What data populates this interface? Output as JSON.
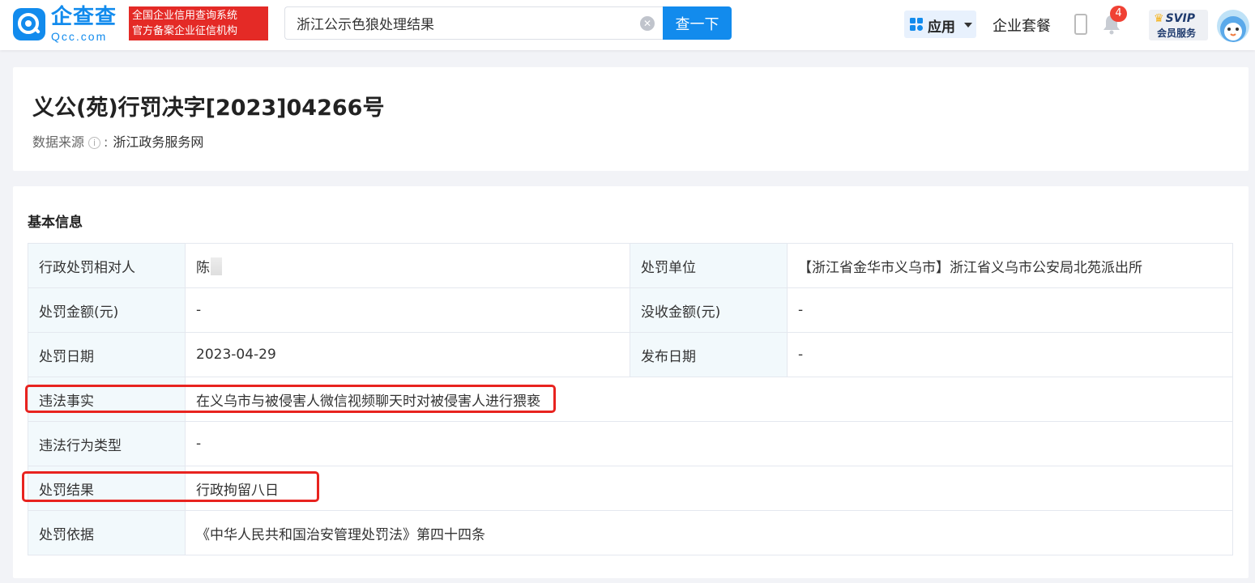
{
  "header": {
    "logo_cn": "企查查",
    "logo_en": "Qcc.com",
    "badge_line1": "全国企业信用查询系统",
    "badge_line2": "官方备案企业征信机构",
    "search_value": "浙江公示色狼处理结果",
    "search_button": "查一下",
    "app_label": "应用",
    "suite_label": "企业套餐",
    "notification_count": "4",
    "svip_label": "SVIP",
    "svip_sub": "会员服务"
  },
  "title_card": {
    "doc_title": "义公(苑)行罚决字[2023]04266号",
    "source_label": "数据来源",
    "source_value": "浙江政务服务网"
  },
  "basic_info": {
    "section_title": "基本信息",
    "rows": {
      "subject_label": "行政处罚相对人",
      "subject_value": "陈",
      "unit_label": "处罚单位",
      "unit_value": "【浙江省金华市义乌市】浙江省义乌市公安局北苑派出所",
      "fine_label": "处罚金额(元)",
      "fine_value": "-",
      "confiscate_label": "没收金额(元)",
      "confiscate_value": "-",
      "date_label": "处罚日期",
      "date_value": "2023-04-29",
      "publish_label": "发布日期",
      "publish_value": "-",
      "facts_label": "违法事实",
      "facts_value": "在义乌市与被侵害人微信视频聊天时对被侵害人进行猥亵",
      "type_label": "违法行为类型",
      "type_value": "-",
      "result_label": "处罚结果",
      "result_value": "行政拘留八日",
      "basis_label": "处罚依据",
      "basis_value": "《中华人民共和国治安管理处罚法》第四十四条"
    }
  },
  "colors": {
    "brand": "#128bed",
    "badge_red": "#e42a26",
    "highlight_red": "#e8231f",
    "label_bg": "#f2f9fc"
  }
}
